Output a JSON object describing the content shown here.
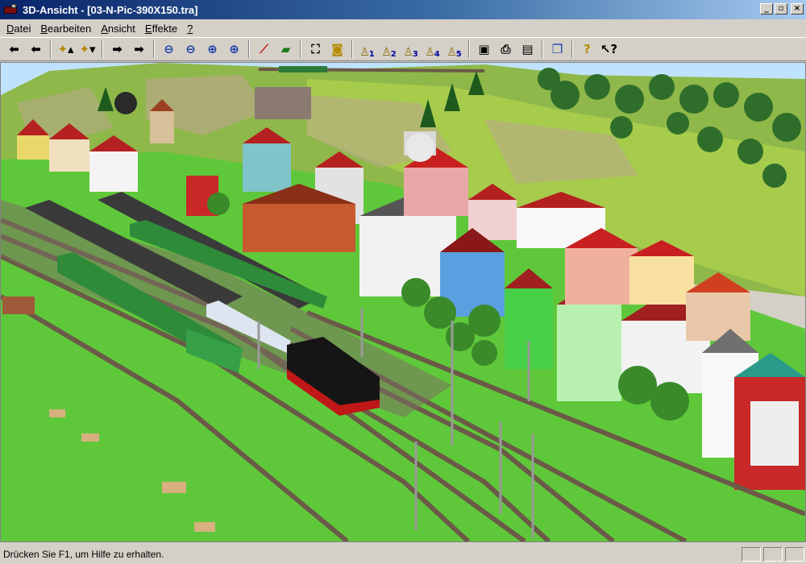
{
  "window": {
    "title": "3D-Ansicht - [03-N-Pic-390X150.tra]",
    "controls": {
      "minimize": "_",
      "restore": "▫",
      "close": "×"
    }
  },
  "menu": {
    "items": [
      {
        "accel": "D",
        "rest": "atei"
      },
      {
        "accel": "B",
        "rest": "earbeiten"
      },
      {
        "accel": "A",
        "rest": "nsicht"
      },
      {
        "accel": "E",
        "rest": "ffekte"
      },
      {
        "accel": "?",
        "rest": ""
      }
    ]
  },
  "toolbar": {
    "camera_numbers": [
      "1",
      "2",
      "3",
      "4",
      "5"
    ],
    "icons": {
      "back": "arrow-left-icon",
      "back2": "arrow-left-bold-icon",
      "walk_forward": "walker-up-icon",
      "walk_down": "walker-down-icon",
      "redo": "arrow-right-icon",
      "redo2": "arrow-right-bold-icon",
      "zoom_out_full": "zoom-extents-out-icon",
      "zoom_out": "zoom-out-icon",
      "zoom_in": "zoom-in-icon",
      "zoom_in_full": "zoom-extents-in-icon",
      "track": "track-icon",
      "wagon": "wagon-icon",
      "fit": "fit-view-icon",
      "snapshot": "camera-icon",
      "save": "save-icon",
      "print": "print-icon",
      "preview": "print-preview-icon",
      "copy": "copy-icon",
      "help": "help-icon",
      "context_help": "context-help-icon"
    },
    "colors": {
      "camera_figure": "#8a6a00",
      "camera_number": "#0000a0"
    }
  },
  "status": {
    "text": "Drücken Sie F1, um Hilfe zu erhalten."
  },
  "scene": {
    "colors": {
      "sky": "#bfe3ff",
      "grass": "#5fc83a",
      "hill": "#8fb84a",
      "rock": "#b8a888",
      "track": "#6b5a48",
      "platform_roof": "#3a3a3a",
      "train_green": "#2e8b3a",
      "steam_loco": "#151515",
      "roof_red": "#b52020",
      "house_white": "#f2f2f2",
      "house_green": "#48d048"
    }
  }
}
